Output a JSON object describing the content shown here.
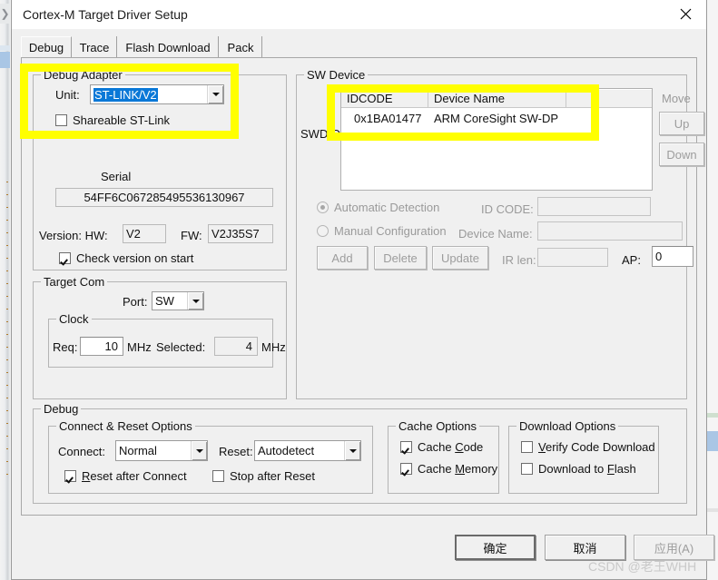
{
  "window": {
    "title": "Cortex-M Target Driver Setup",
    "close_icon": "close-icon"
  },
  "tabs": [
    {
      "label": "Debug",
      "active": true
    },
    {
      "label": "Trace",
      "active": false
    },
    {
      "label": "Flash Download",
      "active": false
    },
    {
      "label": "Pack",
      "active": false
    }
  ],
  "debug_adapter": {
    "legend": "Debug Adapter",
    "unit_label": "Unit:",
    "unit_value": "ST-LINK/V2",
    "shareable_label": "Shareable ST-Link",
    "shareable_checked": false,
    "serial_label": "Serial",
    "serial_value": "54FF6C067285495536130967",
    "version_label": "Version: HW:",
    "hw_value": "V2",
    "fw_label": "FW:",
    "fw_value": "V2J35S7",
    "check_version_label": "Check version on start",
    "check_version_checked": true
  },
  "target_com": {
    "legend": "Target Com",
    "port_label": "Port:",
    "port_value": "SW",
    "clock_legend": "Clock",
    "req_label": "Req:",
    "req_value": "10",
    "req_unit": "MHz",
    "selected_label": "Selected:",
    "selected_value": "4",
    "selected_unit": "MHz"
  },
  "sw_device": {
    "legend": "SW Device",
    "swdio_label": "SWDIO",
    "columns": [
      "IDCODE",
      "Device Name",
      ""
    ],
    "rows": [
      {
        "idcode": "0x1BA01477",
        "device_name": "ARM CoreSight SW-DP",
        "extra": ""
      }
    ],
    "move_label": "Move",
    "up_label": "Up",
    "down_label": "Down",
    "automatic_detection_label": "Automatic Detection",
    "automatic_detection_selected": true,
    "manual_configuration_label": "Manual Configuration",
    "manual_configuration_selected": false,
    "id_code_label": "ID CODE:",
    "id_code_value": "",
    "device_name_label": "Device Name:",
    "device_name_value": "",
    "ir_len_label": "IR len:",
    "ir_len_value": "",
    "ap_label": "AP:",
    "ap_value": "0",
    "add_label": "Add",
    "delete_label": "Delete",
    "update_label": "Update"
  },
  "debug_group": {
    "legend": "Debug",
    "connect_reset": {
      "legend": "Connect & Reset Options",
      "connect_label": "Connect:",
      "connect_value": "Normal",
      "reset_label": "Reset:",
      "reset_value": "Autodetect",
      "reset_after_connect_label_pre": "R",
      "reset_after_connect_label_post": "eset after Connect",
      "reset_after_connect_checked": true,
      "stop_after_reset_label": "Stop after Reset",
      "stop_after_reset_checked": false
    },
    "cache": {
      "legend": "Cache Options",
      "cache_code_pre": "Cache ",
      "cache_code_key": "C",
      "cache_code_post": "ode",
      "cache_code_checked": true,
      "cache_memory_pre": "Cache ",
      "cache_memory_key": "M",
      "cache_memory_post": "emory",
      "cache_memory_checked": true
    },
    "download": {
      "legend": "Download Options",
      "verify_pre": "",
      "verify_key": "V",
      "verify_post": "erify Code Download",
      "verify_checked": false,
      "flash_pre": "Download to ",
      "flash_key": "F",
      "flash_post": "lash",
      "flash_checked": false
    }
  },
  "footer": {
    "ok_label": "确定",
    "cancel_label": "取消",
    "apply_label": "应用(A)"
  },
  "watermark": "CSDN @老王WHH",
  "colors": {
    "highlight": "#ffff00",
    "selection": "#0a78d7",
    "dialog_bg": "#f0f0f0"
  }
}
